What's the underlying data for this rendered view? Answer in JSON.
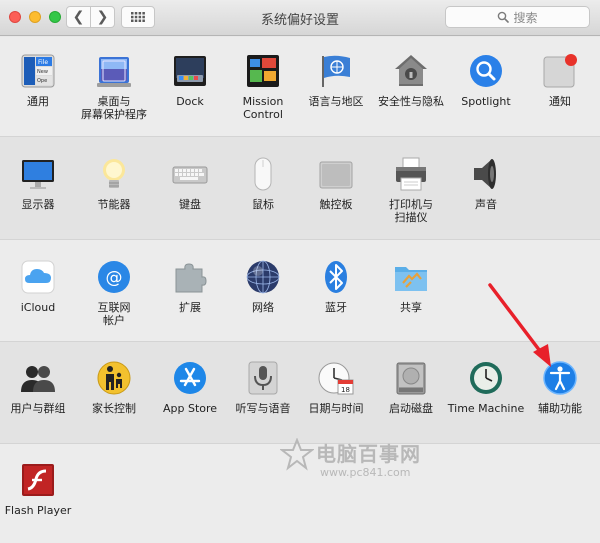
{
  "window": {
    "title": "系统偏好设置",
    "search_placeholder": "搜索",
    "back_glyph": "❮",
    "forward_glyph": "❯"
  },
  "rows": [
    {
      "items": [
        {
          "name": "general",
          "label": "通用",
          "icon": "general-icon"
        },
        {
          "name": "desktop-screensaver",
          "label": "桌面与\n屏幕保护程序",
          "icon": "desktop-screensaver-icon"
        },
        {
          "name": "dock",
          "label": "Dock",
          "icon": "dock-icon"
        },
        {
          "name": "mission-control",
          "label": "Mission\nControl",
          "icon": "mission-control-icon"
        },
        {
          "name": "language-region",
          "label": "语言与地区",
          "icon": "flag-icon"
        },
        {
          "name": "security-privacy",
          "label": "安全性与隐私",
          "icon": "security-house-icon"
        },
        {
          "name": "spotlight",
          "label": "Spotlight",
          "icon": "spotlight-icon"
        },
        {
          "name": "notifications",
          "label": "通知",
          "icon": "notifications-icon"
        }
      ]
    },
    {
      "items": [
        {
          "name": "displays",
          "label": "显示器",
          "icon": "display-icon"
        },
        {
          "name": "energy-saver",
          "label": "节能器",
          "icon": "lightbulb-icon"
        },
        {
          "name": "keyboard",
          "label": "键盘",
          "icon": "keyboard-icon"
        },
        {
          "name": "mouse",
          "label": "鼠标",
          "icon": "mouse-icon"
        },
        {
          "name": "trackpad",
          "label": "触控板",
          "icon": "trackpad-icon"
        },
        {
          "name": "printers-scanners",
          "label": "打印机与\n扫描仪",
          "icon": "printer-icon"
        },
        {
          "name": "sound",
          "label": "声音",
          "icon": "speaker-icon"
        }
      ]
    },
    {
      "items": [
        {
          "name": "icloud",
          "label": "iCloud",
          "icon": "icloud-icon"
        },
        {
          "name": "internet-accounts",
          "label": "互联网\n帐户",
          "icon": "internet-accounts-icon"
        },
        {
          "name": "extensions",
          "label": "扩展",
          "icon": "puzzle-icon"
        },
        {
          "name": "network",
          "label": "网络",
          "icon": "globe-icon"
        },
        {
          "name": "bluetooth",
          "label": "蓝牙",
          "icon": "bluetooth-icon"
        },
        {
          "name": "sharing",
          "label": "共享",
          "icon": "sharing-folder-icon"
        }
      ]
    },
    {
      "items": [
        {
          "name": "users-groups",
          "label": "用户与群组",
          "icon": "users-icon"
        },
        {
          "name": "parental-controls",
          "label": "家长控制",
          "icon": "parental-controls-icon"
        },
        {
          "name": "app-store",
          "label": "App Store",
          "icon": "app-store-icon"
        },
        {
          "name": "dictation-speech",
          "label": "听写与语音",
          "icon": "microphone-icon"
        },
        {
          "name": "date-time",
          "label": "日期与时间",
          "icon": "clock-calendar-icon"
        },
        {
          "name": "startup-disk",
          "label": "启动磁盘",
          "icon": "hard-disk-icon"
        },
        {
          "name": "time-machine",
          "label": "Time Machine",
          "icon": "time-machine-icon"
        },
        {
          "name": "accessibility",
          "label": "辅助功能",
          "icon": "accessibility-icon"
        }
      ]
    },
    {
      "items": [
        {
          "name": "flash-player",
          "label": "Flash Player",
          "icon": "flash-icon"
        }
      ]
    }
  ],
  "watermark": {
    "title": "电脑百事网",
    "url": "www.pc841.com"
  },
  "colors": {
    "annotation_arrow": "#e8202a",
    "accent_blue": "#1e88e5"
  }
}
